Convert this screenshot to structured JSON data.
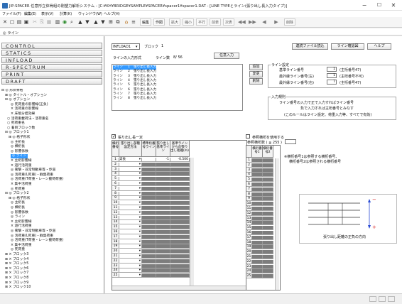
{
  "window": {
    "title": "JIP-SPACER 任意形立体骨組の剛塑力解析システム - [C:¥KHYBRIDGE¥SAMPLE¥SPACER¥spacer1¥spacer1.DAT - [LINE TYPEとライン(張り出し長入力タイプ)]",
    "minimize": "−",
    "maximize": "☐",
    "close": "✕"
  },
  "menu": [
    "ファイル(F)",
    "編集(E)",
    "表示(V)",
    "計算(K)",
    "ウィンドウ(W)",
    "ヘルプ(H)"
  ],
  "toolbar": {
    "text_buttons": [
      "編集",
      "作図",
      "拡大",
      "縮小",
      "平行",
      "前表",
      "次表",
      "前",
      "後",
      "削除"
    ]
  },
  "breadcrumb": "◎ ライン",
  "sidebar": {
    "nav_buttons": [
      "CONTROL",
      "STATICS",
      "INFLOAD",
      "R-SPECTRUM",
      "PRINT",
      "DRAFT"
    ],
    "tree": [
      "⊟ ◎ 形状骨格",
      "⊞ ◎ タイトル・オプション",
      "⊟ ◎ オプション",
      "◎ 死荷重の影響線(正負)",
      "× 活荷重の影響線",
      "× 床版分担効果",
      "○ 活荷重載荷法・活荷重名",
      "○ 死荷重名",
      "○ 着目ブロック数",
      "⊟ ◎ ブロック1",
      "⊞ ◎ 格子形状",
      "◎ 主桁長",
      "◎ 横桁長",
      "◎ 影響係数",
      "◎ ライン",
      "× 主桁影響線",
      "× 遊行活荷重",
      "◎ 衝撃・非常制動車等・歩道",
      "◎ 活荷重(L死重)・群集荷重",
      "◎ 活荷重(T荷重・レーン載荷荷重)",
      "× 集中活荷重",
      "◎ 死荷重",
      "⊟ ◎ ブロック2",
      "⊞ ◎ 格子形状",
      "◎ 主桁長",
      "◎ 横桁長",
      "◎ 影響係数",
      "◎ ライン",
      "× 主桁影響線",
      "× 遊行活荷重",
      "◎ 衝撃・非常制動車等・歩道",
      "◎ 活荷重(L死重)・群集荷重",
      "◎ 活荷重(T荷重・レーン載荷荷重)",
      "× 集中活荷重",
      "◎ 死荷重",
      "⊞ × ブロック3",
      "⊞ × ブロック4",
      "⊞ × ブロック5",
      "⊞ × ブロック6",
      "⊞ × ブロック7",
      "⊞ × ブロック8",
      "⊞ × ブロック9",
      "⊞ × ブロック10"
    ]
  },
  "top_bar": {
    "select_value": "INFLOAD1",
    "block_label": "ブロック",
    "block_number": "1",
    "buttons": [
      "連続ファイル読込",
      "ライン確認図",
      "ヘルプ"
    ]
  },
  "line_input": {
    "heading": "ラインの入力形式",
    "count_label": "ライン数",
    "count": "8/ 56",
    "mode_button": "任意入力",
    "rows": [
      [
        "ライン",
        "1",
        "張り出し長入力"
      ],
      [
        "ライン",
        "2",
        "張り出し長入力"
      ],
      [
        "ライン",
        "3",
        "張り出し長入力"
      ],
      [
        "ライン",
        "4",
        "張り出し長入力"
      ],
      [
        "ライン",
        "5",
        "張り出し長入力"
      ],
      [
        "ライン",
        "6",
        "張り出し長入力"
      ],
      [
        "ライン",
        "7",
        "張り出し長入力"
      ],
      [
        "ライン",
        "8",
        "張り出し長入力"
      ]
    ],
    "side_buttons": [
      "追加",
      "変更",
      "削除"
    ]
  },
  "line_settings": {
    "title": "ライン設定",
    "rows": [
      {
        "label": "基準ライン番号",
        "value": "1",
        "note": "(主桁番号47)"
      },
      {
        "label": "最外縁ライン番号(左)",
        "value": "1",
        "note": "(主桁番号不可)"
      },
      {
        "label": "最外縁ライン番号(右)",
        "value": "7",
        "note": "(主桁番号47)"
      }
    ]
  },
  "rules": {
    "title": "入力規則",
    "lines": [
      "ライン番号の入力で正で入力すればライン番号",
      "負で入力すれば主桁番号とみなす",
      "(このルールはライン設定、荷重入力等、すべてで有効)"
    ]
  },
  "left_grid": {
    "checkbox_label": "張り出し長一定",
    "headers": [
      "横桁番号",
      "張り出し部種設定方法",
      "標準桁番号ライン",
      "張り出し基準ライン",
      "基準ラインからの張り出し距離(m)"
    ],
    "first_row": [
      "1",
      "実長",
      "",
      "-1",
      "-0.500"
    ],
    "row_numbers": [
      "1",
      "2",
      "3",
      "4",
      "5",
      "6",
      "7",
      "8",
      "9",
      "10",
      "11",
      "12",
      "13",
      "14",
      "15",
      "16",
      "17",
      "18",
      "19",
      "20",
      "21",
      "22",
      "23",
      "24",
      "25"
    ]
  },
  "right_grid": {
    "checkbox_label": "参照横桁を使用する",
    "count_label": "参照横桁数 ( ≦ 255 )",
    "count_value": "",
    "headers": [
      "横桁番号1",
      "横桁番号2"
    ],
    "row_numbers": [
      "1",
      "2",
      "3",
      "4",
      "5",
      "6",
      "7",
      "8",
      "9",
      "10",
      "11",
      "12",
      "13",
      "14",
      "15",
      "16",
      "17",
      "18",
      "19",
      "20",
      "21",
      "22",
      "23",
      "24",
      "25"
    ],
    "notes": [
      "※横桁番号1は参照する横桁番号、",
      "横桁番号2は参照される横桁番号"
    ]
  },
  "diagram": {
    "caption": "張り出し距離の正負の方向",
    "minus": "−",
    "plus": "+"
  },
  "accent_colors": {
    "selection": "#3399ff",
    "diagram_arrow": "#2a4bd4",
    "minus_color": "#d42020"
  }
}
